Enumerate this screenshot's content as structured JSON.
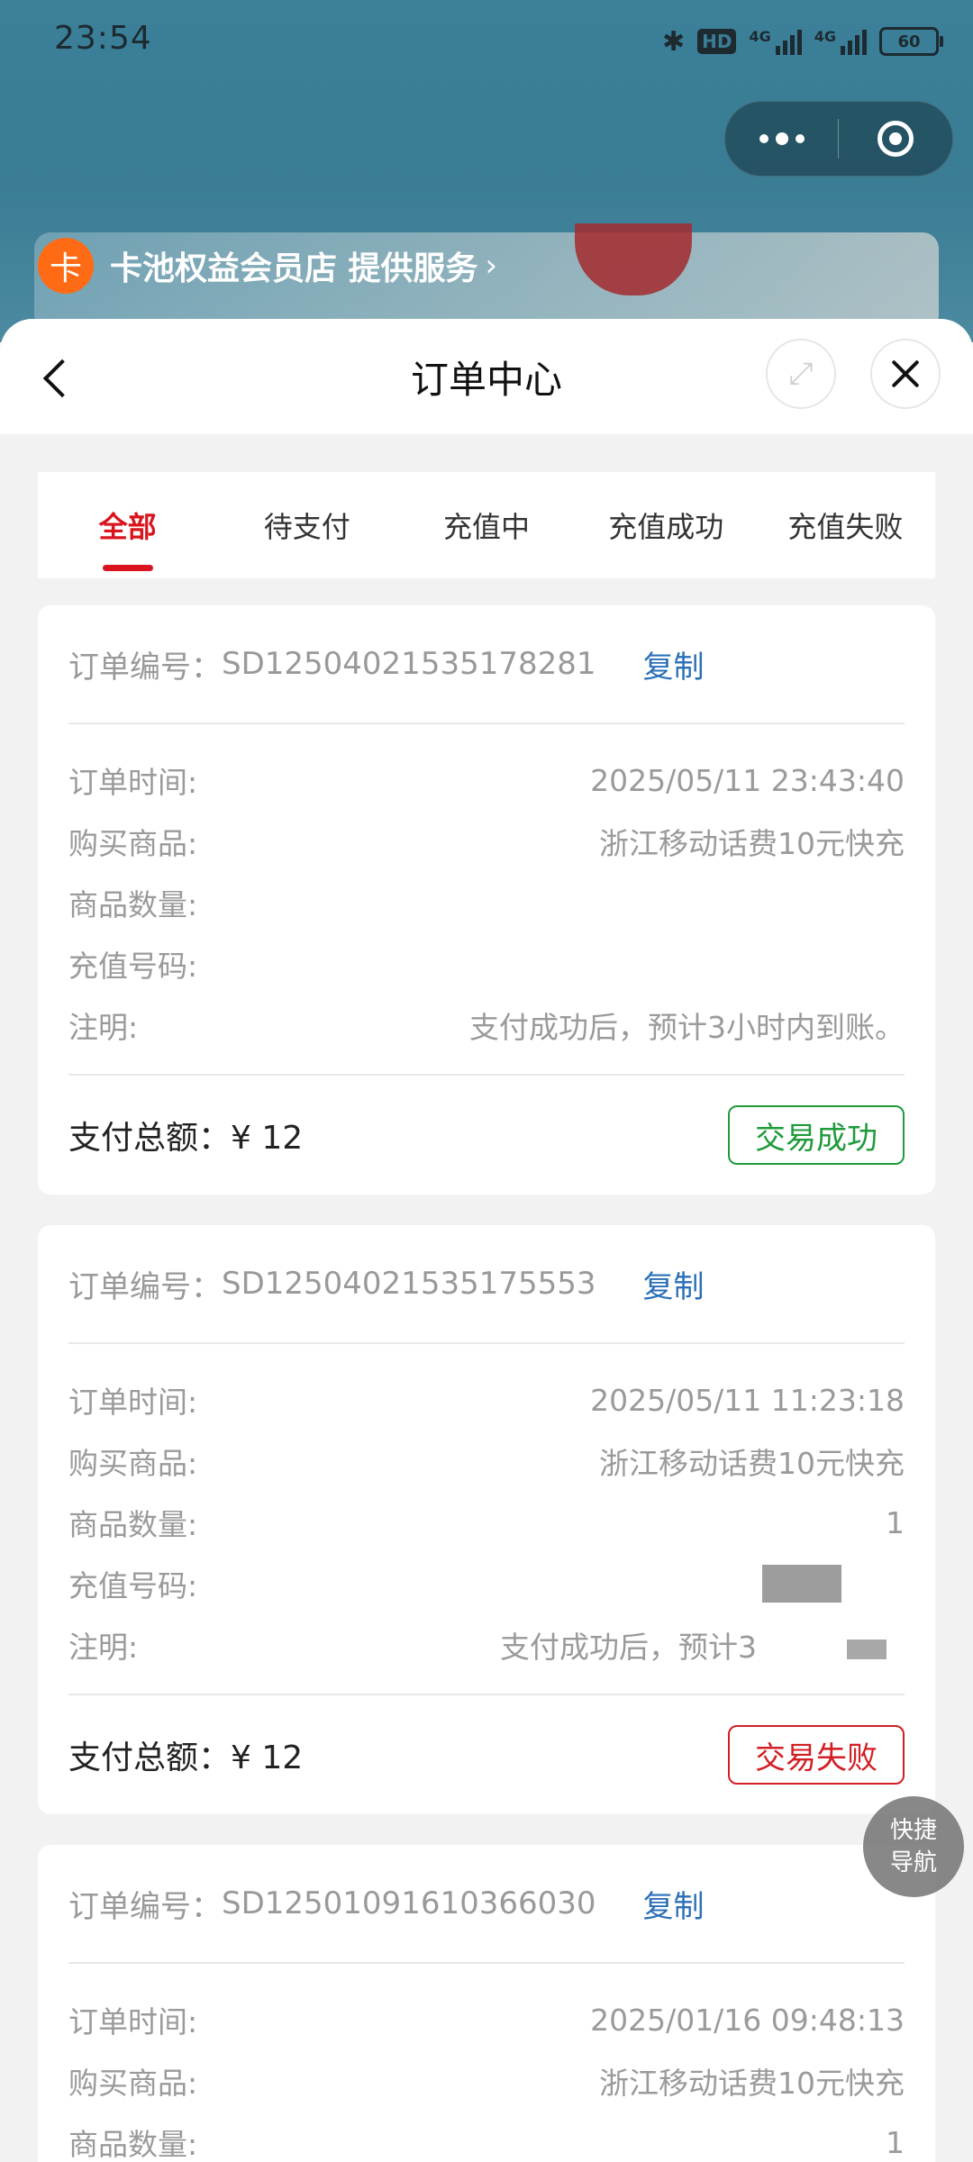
{
  "status_bar": {
    "time": "23:54",
    "hd_label": "HD",
    "network_1": "4G",
    "network_2": "4G",
    "battery": "60"
  },
  "provider": {
    "logo_char": "卡",
    "name": "卡池权益会员店 提供服务",
    "arrow": "›"
  },
  "header": {
    "title": "订单中心"
  },
  "tabs": [
    {
      "label": "全部",
      "active": true
    },
    {
      "label": "待支付",
      "active": false
    },
    {
      "label": "充值中",
      "active": false
    },
    {
      "label": "充值成功",
      "active": false
    },
    {
      "label": "充值失败",
      "active": false
    }
  ],
  "labels": {
    "order_no": "订单编号：",
    "copy": "复制",
    "order_time": "订单时间:",
    "product": "购买商品:",
    "quantity": "商品数量:",
    "phone": "充值号码:",
    "note": "注明:",
    "total_prefix": "支付总额：¥ "
  },
  "orders": [
    {
      "order_no": "SD12504021535178281",
      "time": "2025/05/11 23:43:40",
      "product": "浙江移动话费10元快充",
      "quantity": "",
      "phone": "",
      "note": "支付成功后，预计3小时内到账。",
      "total": "12",
      "status": "交易成功",
      "status_color": "#1f9b3b"
    },
    {
      "order_no": "SD12504021535175553",
      "time": "2025/05/11 11:23:18",
      "product": "浙江移动话费10元快充",
      "quantity": "1",
      "phone": "",
      "note": "支付成功后，预计3",
      "total": "12",
      "status": "交易失败",
      "status_color": "#d21f24"
    },
    {
      "order_no": "SD12501091610366030",
      "time": "2025/01/16 09:48:13",
      "product": "浙江移动话费10元快充",
      "quantity": "1"
    }
  ],
  "quick_nav": {
    "line1": "快捷",
    "line2": "导航"
  }
}
